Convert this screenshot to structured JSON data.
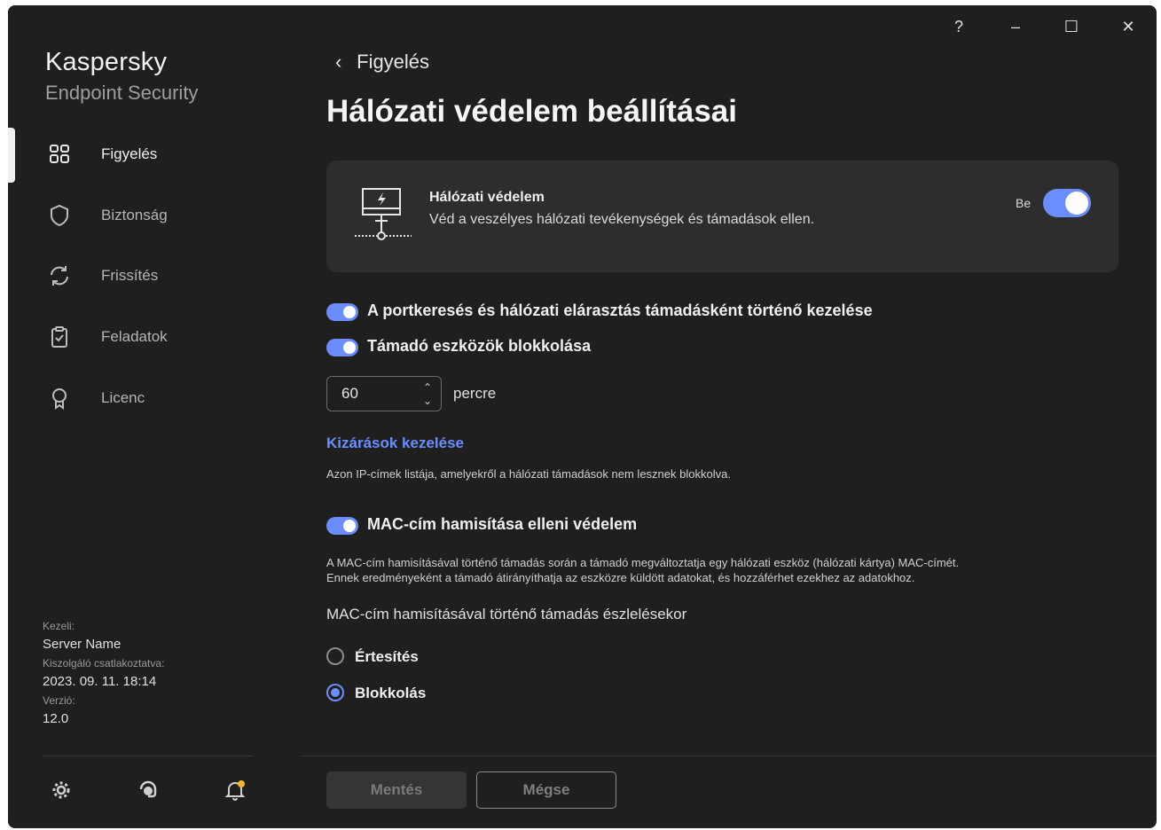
{
  "app": {
    "brand_line1": "Kaspersky",
    "brand_line2": "Endpoint Security"
  },
  "sidebar": {
    "items": [
      {
        "label": "Figyelés",
        "icon": "dashboard-icon",
        "active": true
      },
      {
        "label": "Biztonság",
        "icon": "shield-icon"
      },
      {
        "label": "Frissítés",
        "icon": "refresh-icon"
      },
      {
        "label": "Feladatok",
        "icon": "clipboard-check-icon"
      },
      {
        "label": "Licenc",
        "icon": "license-badge-icon"
      }
    ],
    "meta": {
      "managed_by_label": "Kezeli:",
      "managed_by_value": "Server Name",
      "connected_label": "Kiszolgáló csatlakoztatva:",
      "connected_value": "2023. 09. 11. 18:14",
      "version_label": "Verzió:",
      "version_value": "12.0"
    },
    "bottom_icons": [
      "settings-icon",
      "support-icon",
      "notifications-icon"
    ]
  },
  "titlebar": {
    "help": "?",
    "minimize": "–",
    "maximize": "☐",
    "close": "✕"
  },
  "main": {
    "back_label": "Figyelés",
    "title": "Hálózati védelem beállításai",
    "card": {
      "title": "Hálózati védelem",
      "description": "Véd a veszélyes hálózati tevékenységek és támadások ellen.",
      "toggle_label": "Be",
      "toggle_on": true
    },
    "options": {
      "portscan_label": "A portkeresés és hálózati elárasztás támadásként történő kezelése",
      "block_label": "Támadó eszközök blokkolása",
      "block_minutes": "60",
      "block_unit": "percre",
      "exclusions_link": "Kizárások kezelése",
      "exclusions_desc": "Azon IP-címek listája, amelyekről a hálózati támadások nem lesznek blokkolva.",
      "mac_label": "MAC-cím hamisítása elleni védelem",
      "mac_desc_line1": "A MAC-cím hamisításával történő támadás során a támadó megváltoztatja egy hálózati eszköz (hálózati kártya) MAC-címét.",
      "mac_desc_line2": "Ennek eredményeként a támadó átirányíthatja az eszközre küldött adatokat, és hozzáférhet ezekhez az adatokhoz.",
      "mac_section": "MAC-cím hamisításával történő támadás észlelésekor",
      "radio_notify": "Értesítés",
      "radio_block": "Blokkolás",
      "radio_selected": "Blokkolás"
    },
    "footer": {
      "save": "Mentés",
      "cancel": "Mégse"
    }
  },
  "colors": {
    "accent": "#6b8dff",
    "window_bg": "#1f1f1f",
    "card_bg": "#2d2d2d"
  }
}
